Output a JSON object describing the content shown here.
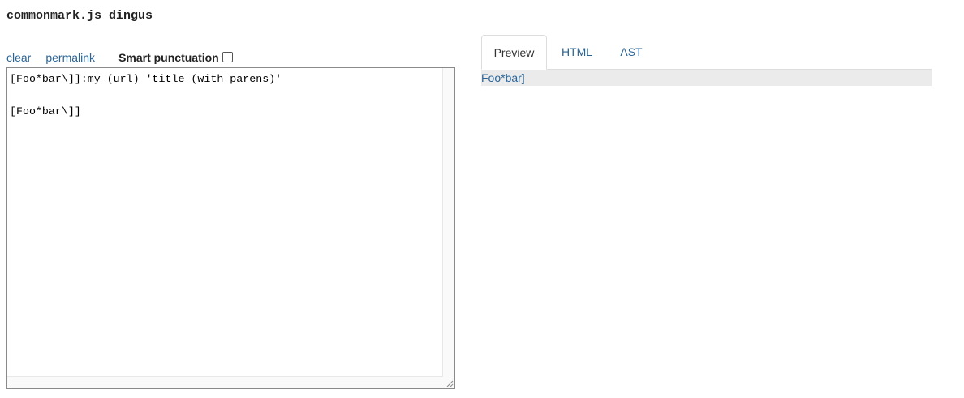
{
  "header": {
    "title": "commonmark.js dingus"
  },
  "controls": {
    "clear_label": "clear",
    "permalink_label": "permalink",
    "smart_punctuation_label": "Smart punctuation",
    "smart_punctuation_checked": false
  },
  "editor": {
    "line_1": "[Foo*bar\\]]:my_(url) 'title (with parens)'",
    "line_2": "",
    "line_3": "[Foo*bar\\]]"
  },
  "tabs": [
    {
      "label": "Preview",
      "active": true
    },
    {
      "label": "HTML",
      "active": false
    },
    {
      "label": "AST",
      "active": false
    }
  ],
  "preview": {
    "link_text": "Foo*bar]"
  },
  "colors": {
    "link": "#2a6496",
    "preview_bg": "#ebebeb"
  }
}
